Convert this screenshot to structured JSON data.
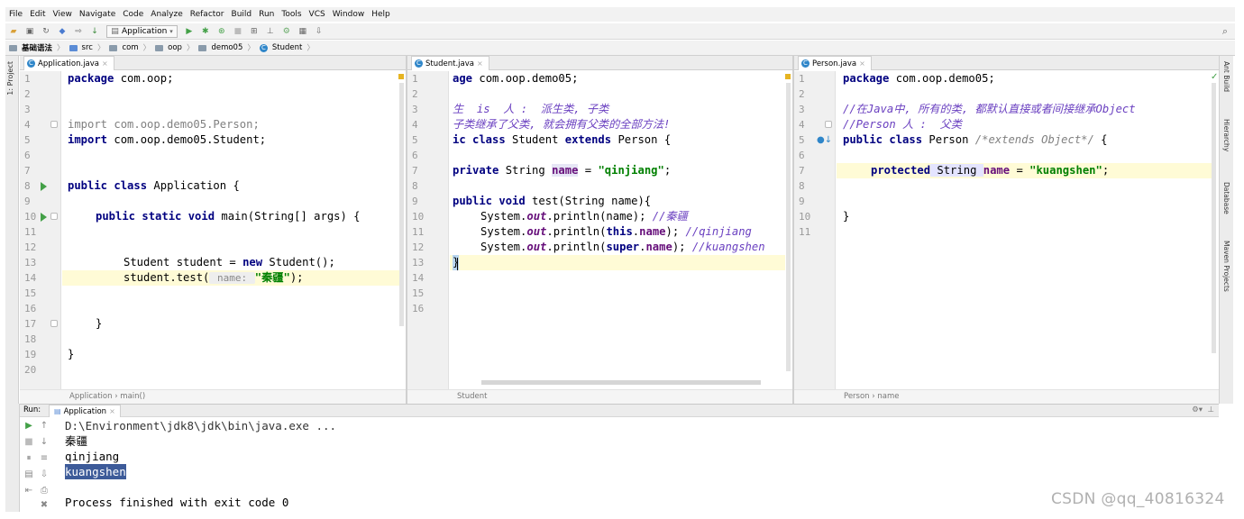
{
  "menu": [
    "File",
    "Edit",
    "View",
    "Navigate",
    "Code",
    "Analyze",
    "Refactor",
    "Build",
    "Run",
    "Tools",
    "VCS",
    "Window",
    "Help"
  ],
  "toolbar": {
    "run_config": "Application"
  },
  "breadcrumb": [
    "基础语法",
    "src",
    "com",
    "oop",
    "demo05",
    "Student"
  ],
  "left_strip": "1: Project",
  "right_strip": [
    "Ant Build",
    "Hierarchy",
    "Database",
    "Maven Projects"
  ],
  "pane1": {
    "tab": "Application.java",
    "line_numbers": [
      "1",
      "2",
      "3",
      "4",
      "5",
      "6",
      "7",
      "8",
      "9",
      "10",
      "11",
      "12",
      "13",
      "14",
      "15",
      "16",
      "17",
      "18",
      "19",
      "20"
    ],
    "breadcrumb": "Application  ›  main()",
    "code": {
      "l1kw": "package",
      "l1r": " com.oop;",
      "l4": "import com.oop.demo05.Person;",
      "l5kw": "import",
      "l5r": " com.oop.demo05.Student;",
      "l8kw": "public class",
      "l8r": " Application {",
      "l10kw": "public static void",
      "l10r": " main(String[] args) {",
      "l13a": "Student student = ",
      "l13kw": "new",
      "l13b": " Student();",
      "l14a": "student.test(",
      "l14hint": " name: ",
      "l14str": "\"秦疆\"",
      "l14b": ");",
      "l17": "}",
      "l19": "}"
    }
  },
  "pane2": {
    "tab": "Student.java",
    "line_numbers": [
      "1",
      "2",
      "3",
      "4",
      "5",
      "6",
      "7",
      "8",
      "9",
      "10",
      "11",
      "12",
      "13",
      "14",
      "15",
      "16"
    ],
    "breadcrumb": "Student",
    "code": {
      "l1kw": "age",
      "l1r": " com.oop.demo05;",
      "l3": "生  is  人 :  派生类, 子类",
      "l4": "子类继承了父类, 就会拥有父类的全部方法!",
      "l5kw": "ic class",
      "l5m": " Student ",
      "l5kw2": "extends",
      "l5r": " Person {",
      "l7kw": "private",
      "l7a": " String ",
      "l7fld": "name",
      "l7b": " = ",
      "l7str": "\"qinjiang\"",
      "l7c": ";",
      "l9kw": "public void",
      "l9r": " test(String name){",
      "l10a": "System.",
      "l10st": "out",
      "l10b": ".println(name); ",
      "l10cm": "//秦疆",
      "l11a": "System.",
      "l11st": "out",
      "l11b": ".println(",
      "l11kw": "this",
      "l11c": ".",
      "l11fld": "name",
      "l11d": "); ",
      "l11cm": "//qinjiang",
      "l12a": "System.",
      "l12st": "out",
      "l12b": ".println(",
      "l12kw": "super",
      "l12c": ".",
      "l12fld": "name",
      "l12d": "); ",
      "l12cm": "//kuangshen",
      "l13": "}"
    }
  },
  "pane3": {
    "tab": "Person.java",
    "line_numbers": [
      "1",
      "2",
      "3",
      "4",
      "5",
      "6",
      "7",
      "8",
      "9",
      "10",
      "11"
    ],
    "breadcrumb": "Person  ›  name",
    "code": {
      "l1kw": "package",
      "l1r": " com.oop.demo05;",
      "l3": "//在Java中, 所有的类, 都默认直接或者间接继承Object",
      "l4": "//Person 人 :  父类",
      "l5kw": "public class",
      "l5m": " Person ",
      "l5cm": "/*extends Object*/",
      "l5r": " {",
      "l7kw": "protected",
      "l7a": " String ",
      "l7fld": "name",
      "l7b": " = ",
      "l7str": "\"kuangshen\"",
      "l7c": ";",
      "l10": "}"
    }
  },
  "run": {
    "label": "Run:",
    "tab": "Application",
    "output": [
      "D:\\Environment\\jdk8\\jdk\\bin\\java.exe ...",
      "秦疆",
      "qinjiang",
      "kuangshen",
      "",
      "Process finished with exit code 0"
    ]
  },
  "watermark": "CSDN @qq_40816324"
}
